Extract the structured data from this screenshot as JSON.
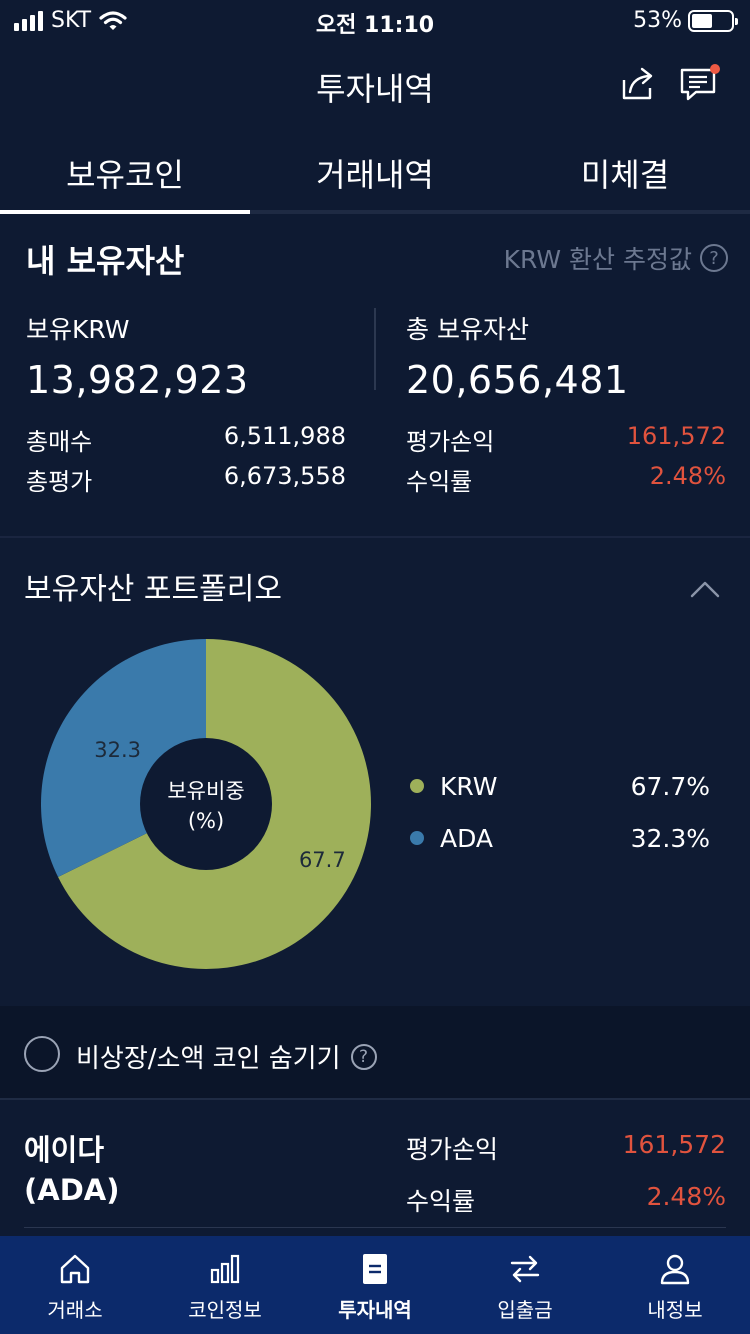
{
  "status_bar": {
    "carrier": "SKT",
    "time": "오전 11:10",
    "battery": "53%",
    "battery_level": 0.53
  },
  "header": {
    "title": "투자내역",
    "share_icon": "share-icon",
    "chat_icon": "chat-icon"
  },
  "tabs": [
    {
      "label": "보유코인",
      "active": true
    },
    {
      "label": "거래내역",
      "active": false
    },
    {
      "label": "미체결",
      "active": false
    }
  ],
  "holdings": {
    "title": "내 보유자산",
    "note": "KRW 환산 추정값",
    "krw_label": "보유KRW",
    "krw_value": "13,982,923",
    "total_label": "총 보유자산",
    "total_value": "20,656,481",
    "buy_label": "총매수",
    "buy_value": "6,511,988",
    "eval_label": "총평가",
    "eval_value": "6,673,558",
    "pnl_label": "평가손익",
    "pnl_value": "161,572",
    "rate_label": "수익률",
    "rate_value": "2.48%"
  },
  "portfolio": {
    "title": "보유자산 포트폴리오",
    "center_label_1": "보유비중",
    "center_label_2": "(%)",
    "legend": [
      {
        "name": "KRW",
        "pct": "67.7%"
      },
      {
        "name": "ADA",
        "pct": "32.3%"
      }
    ]
  },
  "chart_data": {
    "type": "pie",
    "categories": [
      "KRW",
      "ADA"
    ],
    "values": [
      67.7,
      32.3
    ],
    "colors": [
      "#9eb05a",
      "#3a7aab"
    ],
    "data_labels": [
      "67.7",
      "32.3"
    ]
  },
  "hide_small": {
    "label": "비상장/소액 코인 숨기기"
  },
  "coin": {
    "name_line1": "에이다",
    "name_line2": "(ADA)",
    "pnl_label": "평가손익",
    "pnl_value": "161,572",
    "rate_label": "수익률",
    "rate_value": "2.48%"
  },
  "nav": [
    {
      "label": "거래소",
      "icon": "home-icon"
    },
    {
      "label": "코인정보",
      "icon": "bar-chart-icon"
    },
    {
      "label": "투자내역",
      "icon": "document-icon",
      "active": true
    },
    {
      "label": "입출금",
      "icon": "transfer-icon"
    },
    {
      "label": "내정보",
      "icon": "user-icon"
    }
  ],
  "colors": {
    "background": "#0e1a32",
    "accent_red": "#e0533e",
    "nav_bg": "#0c2a6b"
  }
}
